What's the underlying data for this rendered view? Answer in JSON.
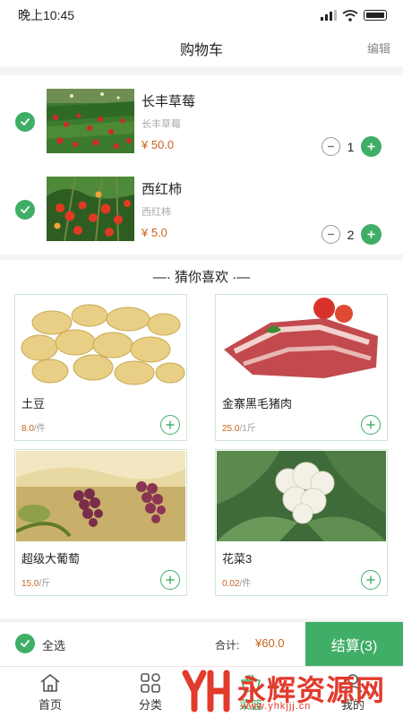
{
  "status_bar": {
    "time": "晚上10:45"
  },
  "header": {
    "title": "购物车",
    "edit_label": "编辑"
  },
  "cart": {
    "items": [
      {
        "name": "长丰草莓",
        "subtitle": "长丰草莓",
        "price": "¥ 50.0",
        "quantity": "1",
        "image": "strawberry-field"
      },
      {
        "name": "西红柿",
        "subtitle": "西红柿",
        "price": "¥ 5.0",
        "quantity": "2",
        "image": "tomato-plant"
      }
    ]
  },
  "recommend": {
    "title": "—· 猜你喜欢 ·—",
    "products": [
      {
        "name": "土豆",
        "price": "8.0",
        "unit": "/件",
        "image": "potatoes"
      },
      {
        "name": "金寨黑毛猪肉",
        "price": "25.0",
        "unit": "/1斤",
        "image": "pork-ribs"
      },
      {
        "name": "超级大葡萄",
        "price": "15.0",
        "unit": "/斤",
        "image": "grapes"
      },
      {
        "name": "花菜3",
        "price": "0.02",
        "unit": "/件",
        "image": "cauliflower"
      }
    ]
  },
  "checkout": {
    "select_all": "全选",
    "total_label": "合计:",
    "total_value": "¥60.0",
    "button": "结算(3)"
  },
  "tabbar": {
    "tabs": [
      {
        "label": "首页",
        "icon": "home-icon"
      },
      {
        "label": "分类",
        "icon": "category-icon"
      },
      {
        "label": "菜篮",
        "icon": "basket-icon"
      },
      {
        "label": "我的",
        "icon": "profile-icon"
      }
    ]
  },
  "watermark": {
    "text": "永辉资源网",
    "url": "www.yhkjjj.cn"
  },
  "colors": {
    "accent": "#3fae66",
    "price": "#c8631d"
  }
}
